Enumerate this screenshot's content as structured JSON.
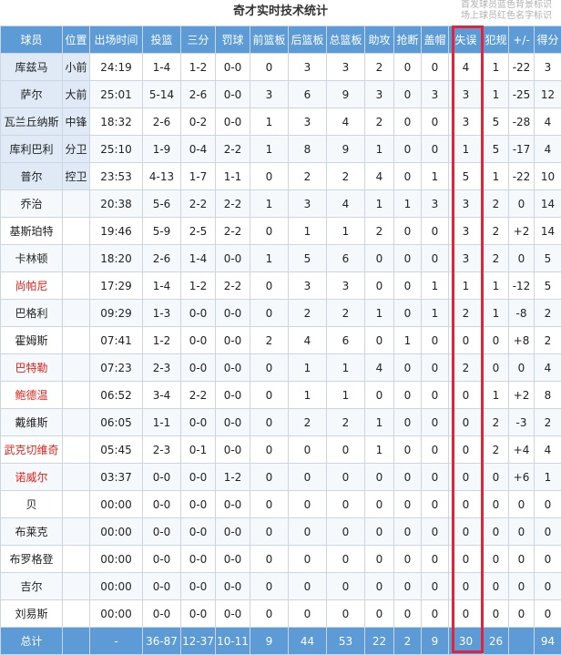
{
  "title": "奇才实时技术统计",
  "legend": [
    "首发球员蓝色背景标识",
    "场上球员红色名字标识"
  ],
  "columns": [
    "球员",
    "位置",
    "出场时间",
    "投篮",
    "三分",
    "罚球",
    "前篮板",
    "后篮板",
    "总篮板",
    "助攻",
    "抢断",
    "盖帽",
    "失误",
    "犯规",
    "+/-",
    "得分"
  ],
  "rows": [
    {
      "name": "库兹马",
      "pos": "小前",
      "min": "24:19",
      "fg": "1-4",
      "tp": "1-2",
      "ft": "0-0",
      "oreb": "0",
      "dreb": "3",
      "reb": "3",
      "ast": "2",
      "stl": "0",
      "blk": "0",
      "tov": "4",
      "pf": "1",
      "pm": "-22",
      "pts": "3",
      "starter": true,
      "oncourt": false
    },
    {
      "name": "萨尔",
      "pos": "大前",
      "min": "25:01",
      "fg": "5-14",
      "tp": "2-6",
      "ft": "0-0",
      "oreb": "3",
      "dreb": "6",
      "reb": "9",
      "ast": "3",
      "stl": "0",
      "blk": "3",
      "tov": "3",
      "pf": "1",
      "pm": "-25",
      "pts": "12",
      "starter": true,
      "oncourt": false
    },
    {
      "name": "瓦兰丘纳斯",
      "pos": "中锋",
      "min": "18:32",
      "fg": "2-6",
      "tp": "0-2",
      "ft": "0-0",
      "oreb": "1",
      "dreb": "3",
      "reb": "4",
      "ast": "2",
      "stl": "0",
      "blk": "0",
      "tov": "3",
      "pf": "5",
      "pm": "-28",
      "pts": "4",
      "starter": true,
      "oncourt": false
    },
    {
      "name": "库利巴利",
      "pos": "分卫",
      "min": "25:10",
      "fg": "1-9",
      "tp": "0-4",
      "ft": "2-2",
      "oreb": "1",
      "dreb": "8",
      "reb": "9",
      "ast": "1",
      "stl": "0",
      "blk": "0",
      "tov": "1",
      "pf": "5",
      "pm": "-17",
      "pts": "4",
      "starter": true,
      "oncourt": false
    },
    {
      "name": "普尔",
      "pos": "控卫",
      "min": "23:53",
      "fg": "4-13",
      "tp": "1-7",
      "ft": "1-1",
      "oreb": "0",
      "dreb": "2",
      "reb": "2",
      "ast": "4",
      "stl": "0",
      "blk": "1",
      "tov": "5",
      "pf": "1",
      "pm": "-22",
      "pts": "10",
      "starter": true,
      "oncourt": false
    },
    {
      "name": "乔治",
      "pos": "",
      "min": "20:38",
      "fg": "5-6",
      "tp": "2-2",
      "ft": "2-2",
      "oreb": "1",
      "dreb": "3",
      "reb": "4",
      "ast": "1",
      "stl": "1",
      "blk": "3",
      "tov": "3",
      "pf": "2",
      "pm": "0",
      "pts": "14",
      "starter": false,
      "oncourt": false
    },
    {
      "name": "基斯珀特",
      "pos": "",
      "min": "19:46",
      "fg": "5-9",
      "tp": "2-5",
      "ft": "2-2",
      "oreb": "0",
      "dreb": "1",
      "reb": "1",
      "ast": "2",
      "stl": "0",
      "blk": "0",
      "tov": "3",
      "pf": "2",
      "pm": "+2",
      "pts": "14",
      "starter": false,
      "oncourt": false
    },
    {
      "name": "卡林顿",
      "pos": "",
      "min": "18:20",
      "fg": "2-6",
      "tp": "1-4",
      "ft": "0-0",
      "oreb": "1",
      "dreb": "5",
      "reb": "6",
      "ast": "0",
      "stl": "0",
      "blk": "0",
      "tov": "3",
      "pf": "2",
      "pm": "0",
      "pts": "5",
      "starter": false,
      "oncourt": false
    },
    {
      "name": "尚帕尼",
      "pos": "",
      "min": "17:29",
      "fg": "1-4",
      "tp": "1-2",
      "ft": "2-2",
      "oreb": "0",
      "dreb": "3",
      "reb": "3",
      "ast": "0",
      "stl": "0",
      "blk": "1",
      "tov": "1",
      "pf": "1",
      "pm": "-12",
      "pts": "5",
      "starter": false,
      "oncourt": true
    },
    {
      "name": "巴格利",
      "pos": "",
      "min": "09:29",
      "fg": "1-3",
      "tp": "0-0",
      "ft": "0-0",
      "oreb": "0",
      "dreb": "2",
      "reb": "2",
      "ast": "1",
      "stl": "0",
      "blk": "1",
      "tov": "2",
      "pf": "1",
      "pm": "-8",
      "pts": "2",
      "starter": false,
      "oncourt": false
    },
    {
      "name": "霍姆斯",
      "pos": "",
      "min": "07:41",
      "fg": "1-2",
      "tp": "0-0",
      "ft": "0-0",
      "oreb": "2",
      "dreb": "4",
      "reb": "6",
      "ast": "0",
      "stl": "1",
      "blk": "0",
      "tov": "0",
      "pf": "0",
      "pm": "+8",
      "pts": "2",
      "starter": false,
      "oncourt": false
    },
    {
      "name": "巴特勒",
      "pos": "",
      "min": "07:23",
      "fg": "2-3",
      "tp": "0-0",
      "ft": "0-0",
      "oreb": "0",
      "dreb": "1",
      "reb": "1",
      "ast": "4",
      "stl": "0",
      "blk": "0",
      "tov": "2",
      "pf": "0",
      "pm": "0",
      "pts": "4",
      "starter": false,
      "oncourt": true
    },
    {
      "name": "鲍德温",
      "pos": "",
      "min": "06:52",
      "fg": "3-4",
      "tp": "2-2",
      "ft": "0-0",
      "oreb": "0",
      "dreb": "1",
      "reb": "1",
      "ast": "0",
      "stl": "0",
      "blk": "0",
      "tov": "0",
      "pf": "1",
      "pm": "+2",
      "pts": "8",
      "starter": false,
      "oncourt": true
    },
    {
      "name": "戴维斯",
      "pos": "",
      "min": "06:05",
      "fg": "1-1",
      "tp": "0-0",
      "ft": "0-0",
      "oreb": "0",
      "dreb": "2",
      "reb": "2",
      "ast": "1",
      "stl": "0",
      "blk": "0",
      "tov": "0",
      "pf": "2",
      "pm": "-3",
      "pts": "2",
      "starter": false,
      "oncourt": false
    },
    {
      "name": "武克切维奇",
      "pos": "",
      "min": "05:45",
      "fg": "2-3",
      "tp": "0-1",
      "ft": "0-0",
      "oreb": "0",
      "dreb": "0",
      "reb": "0",
      "ast": "1",
      "stl": "0",
      "blk": "0",
      "tov": "0",
      "pf": "2",
      "pm": "+4",
      "pts": "4",
      "starter": false,
      "oncourt": true
    },
    {
      "name": "诺威尔",
      "pos": "",
      "min": "03:37",
      "fg": "0-0",
      "tp": "0-0",
      "ft": "1-2",
      "oreb": "0",
      "dreb": "0",
      "reb": "0",
      "ast": "0",
      "stl": "0",
      "blk": "0",
      "tov": "0",
      "pf": "0",
      "pm": "+6",
      "pts": "1",
      "starter": false,
      "oncourt": true
    },
    {
      "name": "贝",
      "pos": "",
      "min": "00:00",
      "fg": "0-0",
      "tp": "0-0",
      "ft": "0-0",
      "oreb": "0",
      "dreb": "0",
      "reb": "0",
      "ast": "0",
      "stl": "0",
      "blk": "0",
      "tov": "0",
      "pf": "0",
      "pm": "0",
      "pts": "0",
      "starter": false,
      "oncourt": false
    },
    {
      "name": "布莱克",
      "pos": "",
      "min": "00:00",
      "fg": "0-0",
      "tp": "0-0",
      "ft": "0-0",
      "oreb": "0",
      "dreb": "0",
      "reb": "0",
      "ast": "0",
      "stl": "0",
      "blk": "0",
      "tov": "0",
      "pf": "0",
      "pm": "0",
      "pts": "0",
      "starter": false,
      "oncourt": false
    },
    {
      "name": "布罗格登",
      "pos": "",
      "min": "00:00",
      "fg": "0-0",
      "tp": "0-0",
      "ft": "0-0",
      "oreb": "0",
      "dreb": "0",
      "reb": "0",
      "ast": "0",
      "stl": "0",
      "blk": "0",
      "tov": "0",
      "pf": "0",
      "pm": "0",
      "pts": "0",
      "starter": false,
      "oncourt": false
    },
    {
      "name": "吉尔",
      "pos": "",
      "min": "00:00",
      "fg": "0-0",
      "tp": "0-0",
      "ft": "0-0",
      "oreb": "0",
      "dreb": "0",
      "reb": "0",
      "ast": "0",
      "stl": "0",
      "blk": "0",
      "tov": "0",
      "pf": "0",
      "pm": "0",
      "pts": "0",
      "starter": false,
      "oncourt": false
    },
    {
      "name": "刘易斯",
      "pos": "",
      "min": "00:00",
      "fg": "0-0",
      "tp": "0-0",
      "ft": "0-0",
      "oreb": "0",
      "dreb": "0",
      "reb": "0",
      "ast": "0",
      "stl": "0",
      "blk": "0",
      "tov": "0",
      "pf": "0",
      "pm": "0",
      "pts": "0",
      "starter": false,
      "oncourt": false
    }
  ],
  "totals": {
    "name": "总计",
    "pos": "",
    "min": "-",
    "fg": "36-87",
    "tp": "12-37",
    "ft": "10-11",
    "oreb": "9",
    "dreb": "44",
    "reb": "53",
    "ast": "22",
    "stl": "2",
    "blk": "9",
    "tov": "30",
    "pf": "26",
    "pm": "",
    "pts": "94"
  },
  "colors": {
    "header": "#5d9bd6",
    "starter": "#dfeaf6",
    "oncourt": "#e2231a",
    "highlight": "#e2233a"
  }
}
